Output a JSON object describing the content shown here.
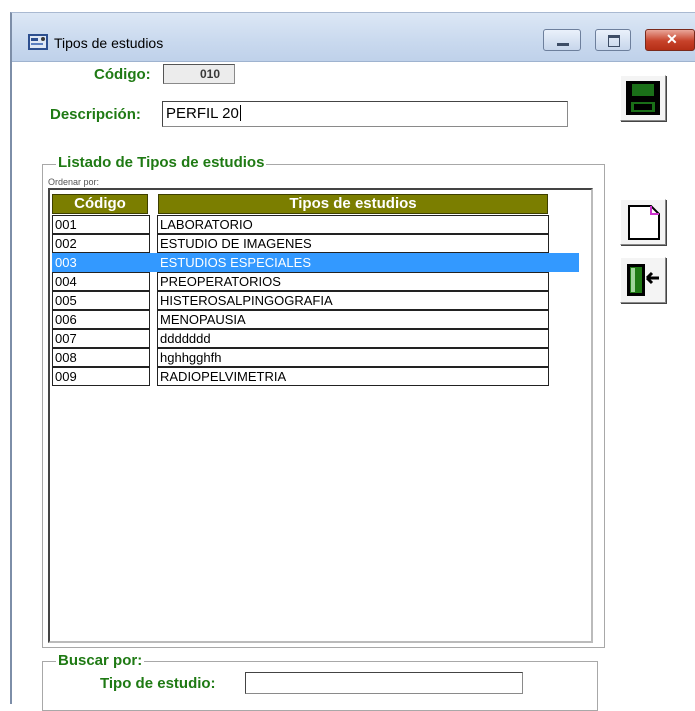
{
  "window": {
    "title": "Tipos de estudios"
  },
  "form": {
    "codigo_label": "Código:",
    "codigo_value": "010",
    "descripcion_label": "Descripción:",
    "descripcion_value": "PERFIL 20"
  },
  "listado": {
    "group_title": "Listado de Tipos de estudios",
    "ordenar_label": "Ordenar por:",
    "columns": [
      "Código",
      "Tipos de estudios"
    ],
    "rows": [
      {
        "codigo": "001",
        "tipo": "LABORATORIO"
      },
      {
        "codigo": "002",
        "tipo": "ESTUDIO DE IMAGENES"
      },
      {
        "codigo": "003",
        "tipo": "ESTUDIOS ESPECIALES"
      },
      {
        "codigo": "004",
        "tipo": "PREOPERATORIOS"
      },
      {
        "codigo": "005",
        "tipo": "HISTEROSALPINGOGRAFIA"
      },
      {
        "codigo": "006",
        "tipo": "MENOPAUSIA"
      },
      {
        "codigo": "007",
        "tipo": "ddddddd"
      },
      {
        "codigo": "008",
        "tipo": "hghhgghfh"
      },
      {
        "codigo": "009",
        "tipo": "RADIOPELVIMETRIA"
      }
    ],
    "selected_index": 2
  },
  "buscar": {
    "group_title": "Buscar por:",
    "tipo_label": "Tipo de estudio:",
    "tipo_value": ""
  },
  "toolbar": {
    "save_icon": "floppy-disk-icon",
    "new_icon": "new-document-icon",
    "exit_icon": "exit-door-icon"
  },
  "colors": {
    "label_green": "#1f7a14",
    "header_olive": "#7b7e00",
    "selection_blue": "#3399ff"
  }
}
